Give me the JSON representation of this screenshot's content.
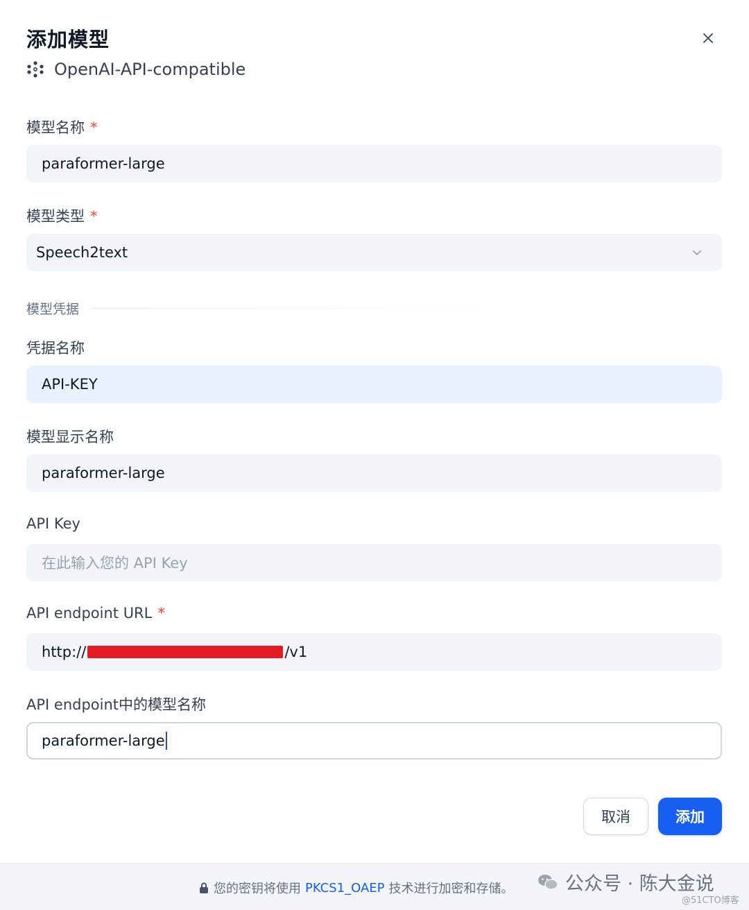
{
  "dialog": {
    "title": "添加模型",
    "provider": "OpenAI-API-compatible"
  },
  "form": {
    "model_name": {
      "label": "模型名称",
      "required": "*",
      "value": "paraformer-large"
    },
    "model_type": {
      "label": "模型类型",
      "required": "*",
      "value": "Speech2text"
    },
    "credentials_section": "模型凭据",
    "credential_name": {
      "label": "凭据名称",
      "value": "API-KEY"
    },
    "display_name": {
      "label": "模型显示名称",
      "value": "paraformer-large"
    },
    "api_key": {
      "label": "API Key",
      "placeholder": "在此输入您的 API Key"
    },
    "endpoint_url": {
      "label": "API endpoint URL",
      "required": "*",
      "value_prefix": "http://",
      "value_suffix": "/v1"
    },
    "endpoint_model_name": {
      "label": "API endpoint中的模型名称",
      "value": "paraformer-large"
    }
  },
  "actions": {
    "cancel_label": "取消",
    "add_label": "添加"
  },
  "footer": {
    "text_before": "您的密钥将使用",
    "link": "PKCS1_OAEP",
    "text_after": "技术进行加密和存储。"
  },
  "watermark": {
    "text": "公众号 · 陈大金说",
    "sub": "@51CTO博客"
  },
  "colors": {
    "primary": "#155eef",
    "required": "#f04438",
    "field_bg": "#f2f4f7",
    "highlight_bg": "#eaf1fe"
  }
}
